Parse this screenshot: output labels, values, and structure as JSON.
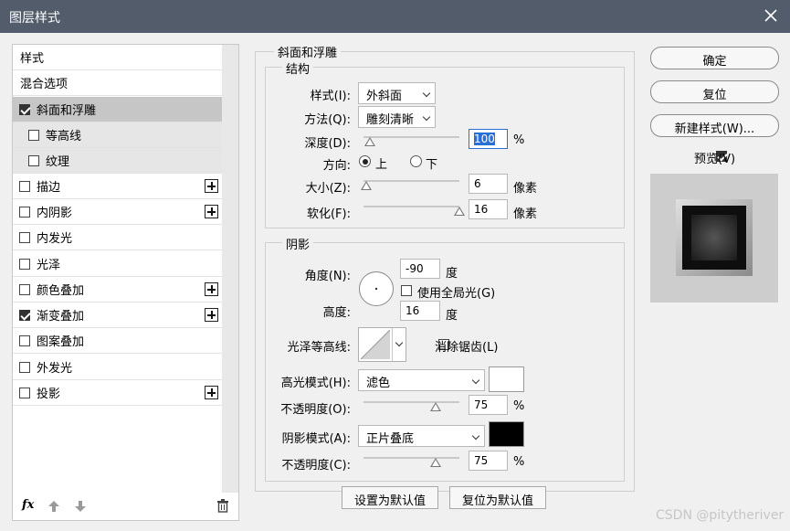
{
  "window": {
    "title": "图层样式"
  },
  "sidebar": {
    "header": "样式",
    "blend": "混合选项",
    "items": [
      {
        "label": "斜面和浮雕",
        "checked": true
      },
      {
        "label": "等高线",
        "checked": false
      },
      {
        "label": "纹理",
        "checked": false
      },
      {
        "label": "描边",
        "checked": false
      },
      {
        "label": "内阴影",
        "checked": false
      },
      {
        "label": "内发光",
        "checked": false
      },
      {
        "label": "光泽",
        "checked": false
      },
      {
        "label": "颜色叠加",
        "checked": false
      },
      {
        "label": "渐变叠加",
        "checked": true
      },
      {
        "label": "图案叠加",
        "checked": false
      },
      {
        "label": "外发光",
        "checked": false
      },
      {
        "label": "投影",
        "checked": false
      }
    ],
    "fx": "fx"
  },
  "bevel": {
    "section": "斜面和浮雕",
    "structure": "结构",
    "style_label": "样式(I):",
    "style_value": "外斜面",
    "technique_label": "方法(Q):",
    "technique_value": "雕刻清晰",
    "depth_label": "深度(D):",
    "depth_value": "100",
    "depth_unit": "%",
    "depth_level": 0.07,
    "direction_label": "方向:",
    "dir_up": "上",
    "dir_down": "下",
    "size_label": "大小(Z):",
    "size_value": "6",
    "size_unit": "像素",
    "size_level": 0.03,
    "soften_label": "软化(F):",
    "soften_value": "16",
    "soften_unit": "像素",
    "soften_level": 1.0
  },
  "shading": {
    "section": "阴影",
    "angle_label": "角度(N):",
    "angle_value": "-90",
    "angle_unit": "度",
    "global_light": "使用全局光(G)",
    "altitude_label": "高度:",
    "altitude_value": "16",
    "altitude_unit": "度",
    "gloss_label": "光泽等高线:",
    "antialias": "消除锯齿(L)",
    "highlight_label": "高光模式(H):",
    "highlight_mode": "滤色",
    "highlight_color": "#ffffff",
    "hl_opacity_label": "不透明度(O):",
    "hl_opacity_value": "75",
    "hl_opacity_unit": "%",
    "hl_opacity_level": 0.75,
    "shadow_label": "阴影模式(A):",
    "shadow_mode": "正片叠底",
    "shadow_color": "#000000",
    "sh_opacity_label": "不透明度(C):",
    "sh_opacity_value": "75",
    "sh_opacity_unit": "%",
    "sh_opacity_level": 0.75
  },
  "footer": {
    "set_default": "设置为默认值",
    "reset_default": "复位为默认值"
  },
  "right": {
    "ok": "确定",
    "reset": "复位",
    "new_style": "新建样式(W)...",
    "preview": "预览(V)"
  },
  "watermark": "CSDN @pitytheriver"
}
